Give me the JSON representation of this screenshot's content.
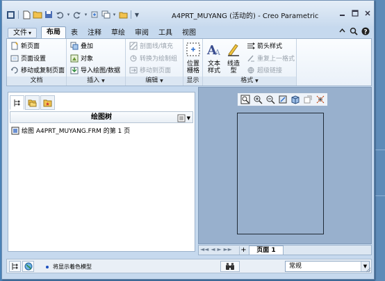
{
  "window": {
    "title_doc": "A4PRT_MUYANG (活动的)",
    "title_sep": " - ",
    "title_app": "Creo Parametric"
  },
  "tabs": [
    {
      "label": "文件",
      "arrow": "▾"
    },
    {
      "label": "布局"
    },
    {
      "label": "表"
    },
    {
      "label": "注释"
    },
    {
      "label": "草绘"
    },
    {
      "label": "审阅"
    },
    {
      "label": "工具"
    },
    {
      "label": "视图"
    }
  ],
  "active_tab": "布局",
  "ribbon": {
    "document": {
      "label": "文档",
      "new_page": "新页面",
      "page_setup": "页面设置",
      "move_copy_pages": "移动或复制页面"
    },
    "insert": {
      "label": "插入",
      "overlay": "叠加",
      "object": "对象",
      "import_drawing": "导入绘图/数据"
    },
    "edit": {
      "label": "编辑",
      "hatch_fill": "剖面线/填充",
      "convert_to_draw_group": "转换为绘制组",
      "move_to_page": "移动到页面"
    },
    "display": {
      "label": "显示",
      "position_grid_1": "位置",
      "position_grid_2": "栅格"
    },
    "format": {
      "label": "格式",
      "text_style_1": "文本",
      "text_style_2": "样式",
      "line_style_1": "线造",
      "line_style_2": "型",
      "arrow_style": "箭头样式",
      "repeat_last_format": "重复上一格式",
      "hyperlink": "超级链接"
    },
    "dropdown_arrow": "▼"
  },
  "model_tree": {
    "title": "绘图树",
    "item": "绘图 A4PRT_MUYANG.FRM 的第 1 页"
  },
  "sheet_bar": {
    "nav": [
      "◄◄",
      "◄",
      "►",
      "►►"
    ],
    "add": "+",
    "page_tab": "页面 1"
  },
  "status": {
    "message": "将显示着色模型",
    "filter_value": "常规"
  },
  "colors": {
    "desktop": "#4a82b8",
    "canvas": "#98b0cd",
    "ribbon": "#eaf1f9"
  }
}
